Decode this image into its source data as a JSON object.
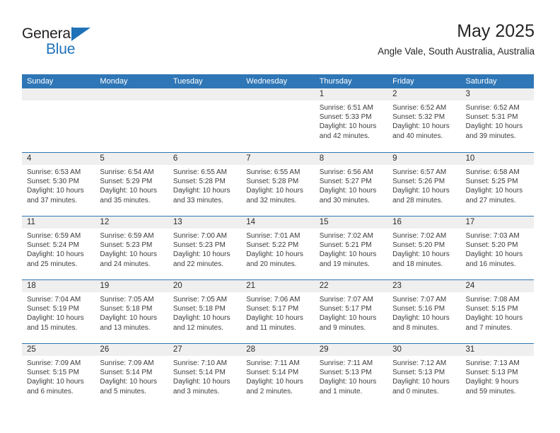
{
  "brand": {
    "name_top": "General",
    "name_bottom": "Blue",
    "accent_color": "#1f72b8"
  },
  "header": {
    "title": "May 2025",
    "subtitle": "Angle Vale, South Australia, Australia"
  },
  "colors": {
    "header_bar": "#2f76b6",
    "day_number_band": "#efefef",
    "text": "#3c3c3c"
  },
  "calendar": {
    "weekday_headers": [
      "Sunday",
      "Monday",
      "Tuesday",
      "Wednesday",
      "Thursday",
      "Friday",
      "Saturday"
    ],
    "weeks": [
      [
        {
          "day": "",
          "lines": []
        },
        {
          "day": "",
          "lines": []
        },
        {
          "day": "",
          "lines": []
        },
        {
          "day": "",
          "lines": []
        },
        {
          "day": "1",
          "lines": [
            "Sunrise: 6:51 AM",
            "Sunset: 5:33 PM",
            "Daylight: 10 hours",
            "and 42 minutes."
          ]
        },
        {
          "day": "2",
          "lines": [
            "Sunrise: 6:52 AM",
            "Sunset: 5:32 PM",
            "Daylight: 10 hours",
            "and 40 minutes."
          ]
        },
        {
          "day": "3",
          "lines": [
            "Sunrise: 6:52 AM",
            "Sunset: 5:31 PM",
            "Daylight: 10 hours",
            "and 39 minutes."
          ]
        }
      ],
      [
        {
          "day": "4",
          "lines": [
            "Sunrise: 6:53 AM",
            "Sunset: 5:30 PM",
            "Daylight: 10 hours",
            "and 37 minutes."
          ]
        },
        {
          "day": "5",
          "lines": [
            "Sunrise: 6:54 AM",
            "Sunset: 5:29 PM",
            "Daylight: 10 hours",
            "and 35 minutes."
          ]
        },
        {
          "day": "6",
          "lines": [
            "Sunrise: 6:55 AM",
            "Sunset: 5:28 PM",
            "Daylight: 10 hours",
            "and 33 minutes."
          ]
        },
        {
          "day": "7",
          "lines": [
            "Sunrise: 6:55 AM",
            "Sunset: 5:28 PM",
            "Daylight: 10 hours",
            "and 32 minutes."
          ]
        },
        {
          "day": "8",
          "lines": [
            "Sunrise: 6:56 AM",
            "Sunset: 5:27 PM",
            "Daylight: 10 hours",
            "and 30 minutes."
          ]
        },
        {
          "day": "9",
          "lines": [
            "Sunrise: 6:57 AM",
            "Sunset: 5:26 PM",
            "Daylight: 10 hours",
            "and 28 minutes."
          ]
        },
        {
          "day": "10",
          "lines": [
            "Sunrise: 6:58 AM",
            "Sunset: 5:25 PM",
            "Daylight: 10 hours",
            "and 27 minutes."
          ]
        }
      ],
      [
        {
          "day": "11",
          "lines": [
            "Sunrise: 6:59 AM",
            "Sunset: 5:24 PM",
            "Daylight: 10 hours",
            "and 25 minutes."
          ]
        },
        {
          "day": "12",
          "lines": [
            "Sunrise: 6:59 AM",
            "Sunset: 5:23 PM",
            "Daylight: 10 hours",
            "and 24 minutes."
          ]
        },
        {
          "day": "13",
          "lines": [
            "Sunrise: 7:00 AM",
            "Sunset: 5:23 PM",
            "Daylight: 10 hours",
            "and 22 minutes."
          ]
        },
        {
          "day": "14",
          "lines": [
            "Sunrise: 7:01 AM",
            "Sunset: 5:22 PM",
            "Daylight: 10 hours",
            "and 20 minutes."
          ]
        },
        {
          "day": "15",
          "lines": [
            "Sunrise: 7:02 AM",
            "Sunset: 5:21 PM",
            "Daylight: 10 hours",
            "and 19 minutes."
          ]
        },
        {
          "day": "16",
          "lines": [
            "Sunrise: 7:02 AM",
            "Sunset: 5:20 PM",
            "Daylight: 10 hours",
            "and 18 minutes."
          ]
        },
        {
          "day": "17",
          "lines": [
            "Sunrise: 7:03 AM",
            "Sunset: 5:20 PM",
            "Daylight: 10 hours",
            "and 16 minutes."
          ]
        }
      ],
      [
        {
          "day": "18",
          "lines": [
            "Sunrise: 7:04 AM",
            "Sunset: 5:19 PM",
            "Daylight: 10 hours",
            "and 15 minutes."
          ]
        },
        {
          "day": "19",
          "lines": [
            "Sunrise: 7:05 AM",
            "Sunset: 5:18 PM",
            "Daylight: 10 hours",
            "and 13 minutes."
          ]
        },
        {
          "day": "20",
          "lines": [
            "Sunrise: 7:05 AM",
            "Sunset: 5:18 PM",
            "Daylight: 10 hours",
            "and 12 minutes."
          ]
        },
        {
          "day": "21",
          "lines": [
            "Sunrise: 7:06 AM",
            "Sunset: 5:17 PM",
            "Daylight: 10 hours",
            "and 11 minutes."
          ]
        },
        {
          "day": "22",
          "lines": [
            "Sunrise: 7:07 AM",
            "Sunset: 5:17 PM",
            "Daylight: 10 hours",
            "and 9 minutes."
          ]
        },
        {
          "day": "23",
          "lines": [
            "Sunrise: 7:07 AM",
            "Sunset: 5:16 PM",
            "Daylight: 10 hours",
            "and 8 minutes."
          ]
        },
        {
          "day": "24",
          "lines": [
            "Sunrise: 7:08 AM",
            "Sunset: 5:15 PM",
            "Daylight: 10 hours",
            "and 7 minutes."
          ]
        }
      ],
      [
        {
          "day": "25",
          "lines": [
            "Sunrise: 7:09 AM",
            "Sunset: 5:15 PM",
            "Daylight: 10 hours",
            "and 6 minutes."
          ]
        },
        {
          "day": "26",
          "lines": [
            "Sunrise: 7:09 AM",
            "Sunset: 5:14 PM",
            "Daylight: 10 hours",
            "and 5 minutes."
          ]
        },
        {
          "day": "27",
          "lines": [
            "Sunrise: 7:10 AM",
            "Sunset: 5:14 PM",
            "Daylight: 10 hours",
            "and 3 minutes."
          ]
        },
        {
          "day": "28",
          "lines": [
            "Sunrise: 7:11 AM",
            "Sunset: 5:14 PM",
            "Daylight: 10 hours",
            "and 2 minutes."
          ]
        },
        {
          "day": "29",
          "lines": [
            "Sunrise: 7:11 AM",
            "Sunset: 5:13 PM",
            "Daylight: 10 hours",
            "and 1 minute."
          ]
        },
        {
          "day": "30",
          "lines": [
            "Sunrise: 7:12 AM",
            "Sunset: 5:13 PM",
            "Daylight: 10 hours",
            "and 0 minutes."
          ]
        },
        {
          "day": "31",
          "lines": [
            "Sunrise: 7:13 AM",
            "Sunset: 5:13 PM",
            "Daylight: 9 hours",
            "and 59 minutes."
          ]
        }
      ]
    ]
  }
}
